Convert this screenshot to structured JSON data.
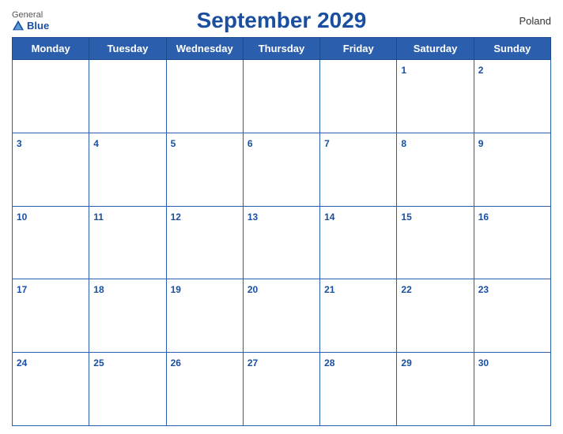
{
  "header": {
    "title": "September 2029",
    "country": "Poland",
    "logo": {
      "general": "General",
      "blue": "Blue"
    }
  },
  "weekdays": [
    "Monday",
    "Tuesday",
    "Wednesday",
    "Thursday",
    "Friday",
    "Saturday",
    "Sunday"
  ],
  "weeks": [
    [
      null,
      null,
      null,
      null,
      null,
      1,
      2
    ],
    [
      3,
      4,
      5,
      6,
      7,
      8,
      9
    ],
    [
      10,
      11,
      12,
      13,
      14,
      15,
      16
    ],
    [
      17,
      18,
      19,
      20,
      21,
      22,
      23
    ],
    [
      24,
      25,
      26,
      27,
      28,
      29,
      30
    ]
  ],
  "colors": {
    "header_bg": "#2b5fad",
    "header_text": "#ffffff",
    "title": "#1a4fa0",
    "day_num": "#1a4fa0"
  }
}
